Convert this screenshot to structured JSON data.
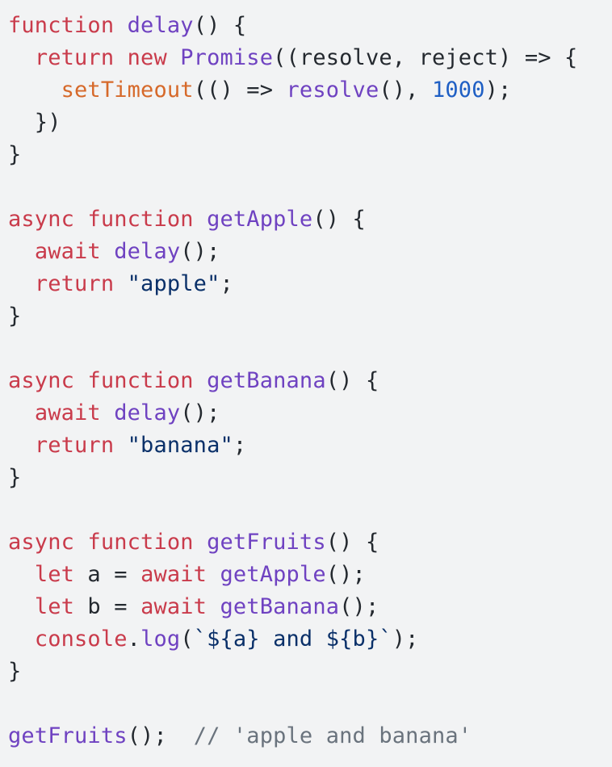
{
  "code": {
    "language": "javascript",
    "line_tops": [
      12,
      52,
      92,
      132,
      172,
      212,
      252,
      292,
      332,
      372,
      412,
      452,
      492,
      532,
      572,
      612,
      652,
      692,
      732,
      772,
      812,
      852,
      892
    ],
    "colors": {
      "background": "#f2f3f4",
      "plain": "#24292f",
      "keyword": "#c93b4b",
      "function": "#6f42c1",
      "string": "#0a3069",
      "number": "#1f5fc4",
      "builtin": "#d6692a",
      "comment": "#6a737d"
    },
    "lines": [
      [
        {
          "t": "keyword",
          "v": "function"
        },
        {
          "t": "plain",
          "v": " "
        },
        {
          "t": "func",
          "v": "delay"
        },
        {
          "t": "plain",
          "v": "() {"
        }
      ],
      [
        {
          "t": "plain",
          "v": "  "
        },
        {
          "t": "keyword",
          "v": "return"
        },
        {
          "t": "plain",
          "v": " "
        },
        {
          "t": "keyword",
          "v": "new"
        },
        {
          "t": "plain",
          "v": " "
        },
        {
          "t": "func",
          "v": "Promise"
        },
        {
          "t": "plain",
          "v": "((resolve, reject) => {"
        }
      ],
      [
        {
          "t": "plain",
          "v": "    "
        },
        {
          "t": "builtin",
          "v": "setTimeout"
        },
        {
          "t": "plain",
          "v": "(() => "
        },
        {
          "t": "func",
          "v": "resolve"
        },
        {
          "t": "plain",
          "v": "(), "
        },
        {
          "t": "number",
          "v": "1000"
        },
        {
          "t": "plain",
          "v": ");"
        }
      ],
      [
        {
          "t": "plain",
          "v": "  })"
        }
      ],
      [
        {
          "t": "plain",
          "v": "}"
        }
      ],
      [],
      [
        {
          "t": "keyword",
          "v": "async"
        },
        {
          "t": "plain",
          "v": " "
        },
        {
          "t": "keyword",
          "v": "function"
        },
        {
          "t": "plain",
          "v": " "
        },
        {
          "t": "func",
          "v": "getApple"
        },
        {
          "t": "plain",
          "v": "() {"
        }
      ],
      [
        {
          "t": "plain",
          "v": "  "
        },
        {
          "t": "keyword",
          "v": "await"
        },
        {
          "t": "plain",
          "v": " "
        },
        {
          "t": "func",
          "v": "delay"
        },
        {
          "t": "plain",
          "v": "();"
        }
      ],
      [
        {
          "t": "plain",
          "v": "  "
        },
        {
          "t": "keyword",
          "v": "return"
        },
        {
          "t": "plain",
          "v": " "
        },
        {
          "t": "string",
          "v": "\"apple\""
        },
        {
          "t": "plain",
          "v": ";"
        }
      ],
      [
        {
          "t": "plain",
          "v": "}"
        }
      ],
      [],
      [
        {
          "t": "keyword",
          "v": "async"
        },
        {
          "t": "plain",
          "v": " "
        },
        {
          "t": "keyword",
          "v": "function"
        },
        {
          "t": "plain",
          "v": " "
        },
        {
          "t": "func",
          "v": "getBanana"
        },
        {
          "t": "plain",
          "v": "() {"
        }
      ],
      [
        {
          "t": "plain",
          "v": "  "
        },
        {
          "t": "keyword",
          "v": "await"
        },
        {
          "t": "plain",
          "v": " "
        },
        {
          "t": "func",
          "v": "delay"
        },
        {
          "t": "plain",
          "v": "();"
        }
      ],
      [
        {
          "t": "plain",
          "v": "  "
        },
        {
          "t": "keyword",
          "v": "return"
        },
        {
          "t": "plain",
          "v": " "
        },
        {
          "t": "string",
          "v": "\"banana\""
        },
        {
          "t": "plain",
          "v": ";"
        }
      ],
      [
        {
          "t": "plain",
          "v": "}"
        }
      ],
      [],
      [
        {
          "t": "keyword",
          "v": "async"
        },
        {
          "t": "plain",
          "v": " "
        },
        {
          "t": "keyword",
          "v": "function"
        },
        {
          "t": "plain",
          "v": " "
        },
        {
          "t": "func",
          "v": "getFruits"
        },
        {
          "t": "plain",
          "v": "() {"
        }
      ],
      [
        {
          "t": "plain",
          "v": "  "
        },
        {
          "t": "keyword",
          "v": "let"
        },
        {
          "t": "plain",
          "v": " a = "
        },
        {
          "t": "keyword",
          "v": "await"
        },
        {
          "t": "plain",
          "v": " "
        },
        {
          "t": "func",
          "v": "getApple"
        },
        {
          "t": "plain",
          "v": "();"
        }
      ],
      [
        {
          "t": "plain",
          "v": "  "
        },
        {
          "t": "keyword",
          "v": "let"
        },
        {
          "t": "plain",
          "v": " b = "
        },
        {
          "t": "keyword",
          "v": "await"
        },
        {
          "t": "plain",
          "v": " "
        },
        {
          "t": "func",
          "v": "getBanana"
        },
        {
          "t": "plain",
          "v": "();"
        }
      ],
      [
        {
          "t": "plain",
          "v": "  "
        },
        {
          "t": "keyword",
          "v": "console"
        },
        {
          "t": "plain",
          "v": "."
        },
        {
          "t": "func",
          "v": "log"
        },
        {
          "t": "plain",
          "v": "("
        },
        {
          "t": "string",
          "v": "`${a} and ${b}`"
        },
        {
          "t": "plain",
          "v": ");"
        }
      ],
      [
        {
          "t": "plain",
          "v": "}"
        }
      ],
      [],
      [
        {
          "t": "func",
          "v": "getFruits"
        },
        {
          "t": "plain",
          "v": "();  "
        },
        {
          "t": "comment",
          "v": "// 'apple and banana'"
        }
      ]
    ]
  }
}
